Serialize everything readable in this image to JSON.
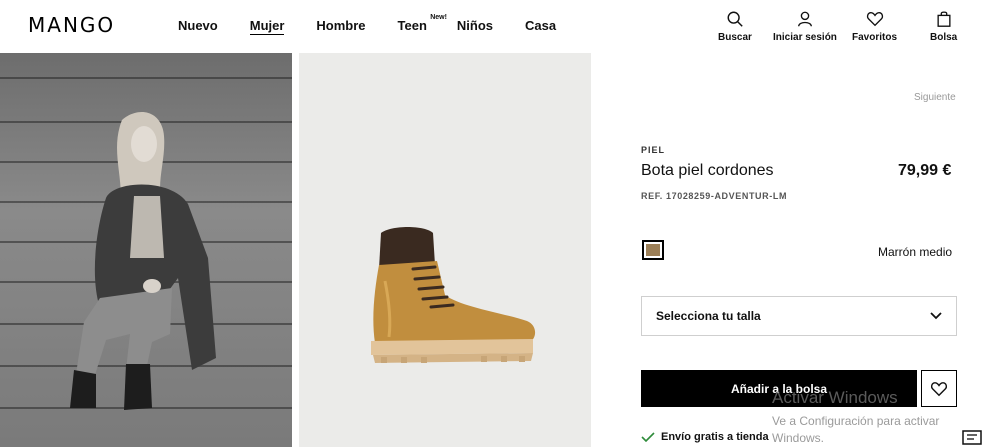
{
  "header": {
    "logo": "MANGO",
    "nav": [
      {
        "label": "Nuevo"
      },
      {
        "label": "Mujer",
        "active": true
      },
      {
        "label": "Hombre"
      },
      {
        "label": "Teen",
        "badge": "New!"
      },
      {
        "label": "Niños"
      },
      {
        "label": "Casa"
      }
    ],
    "actions": {
      "search": "Buscar",
      "login": "Iniciar sesión",
      "favorites": "Favoritos",
      "bag": "Bolsa"
    }
  },
  "product": {
    "next_link": "Siguiente",
    "category": "PIEL",
    "title": "Bota piel cordones",
    "price": "79,99 €",
    "ref": "REF. 17028259-ADVENTUR-LM",
    "color_name": "Marrón medio",
    "swatch_color": "#9c7f57",
    "size_placeholder": "Selecciona tu talla",
    "add_to_bag": "Añadir a la bolsa",
    "shipping": "Envío gratis a tienda"
  },
  "watermark": {
    "title": "Activar Windows",
    "subtitle": "Ve a Configuración para activar Windows."
  }
}
